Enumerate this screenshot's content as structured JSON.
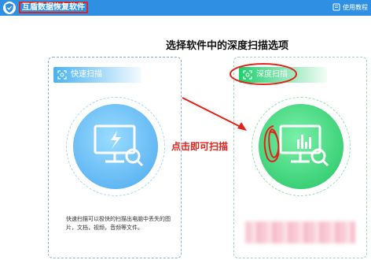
{
  "app": {
    "title": "互盾数据恢复软件",
    "help_label": "使用教程"
  },
  "cards": {
    "quick": {
      "tab_label": "快速扫描",
      "description": "快速扫描可以极快的扫描出电脑中丢失的图片，文档，视频，音频等文件。"
    },
    "deep": {
      "tab_label": "深度扫描"
    }
  },
  "annotations": {
    "instruction": "选择软件中的深度扫描选项",
    "click_hint": "点击即可扫描"
  },
  "colors": {
    "titlebar": "#2f8fe3",
    "quick_accent": "#47b2f3",
    "deep_accent": "#1fcf6d",
    "annotation_red": "#e0241b"
  },
  "icons": {
    "logo": "shield-check-icon",
    "help": "book-icon",
    "quick_scan": "monitor-lightning-icon",
    "deep_scan": "monitor-chart-icon",
    "magnifier": "magnifier-icon"
  }
}
